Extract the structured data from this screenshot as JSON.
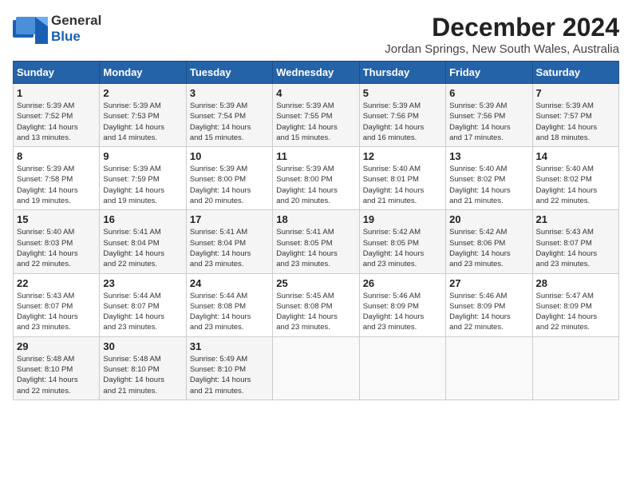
{
  "header": {
    "logo_line1": "General",
    "logo_line2": "Blue",
    "main_title": "December 2024",
    "subtitle": "Jordan Springs, New South Wales, Australia"
  },
  "calendar": {
    "weekdays": [
      "Sunday",
      "Monday",
      "Tuesday",
      "Wednesday",
      "Thursday",
      "Friday",
      "Saturday"
    ],
    "weeks": [
      [
        {
          "day": "1",
          "info": "Sunrise: 5:39 AM\nSunset: 7:52 PM\nDaylight: 14 hours\nand 13 minutes."
        },
        {
          "day": "2",
          "info": "Sunrise: 5:39 AM\nSunset: 7:53 PM\nDaylight: 14 hours\nand 14 minutes."
        },
        {
          "day": "3",
          "info": "Sunrise: 5:39 AM\nSunset: 7:54 PM\nDaylight: 14 hours\nand 15 minutes."
        },
        {
          "day": "4",
          "info": "Sunrise: 5:39 AM\nSunset: 7:55 PM\nDaylight: 14 hours\nand 15 minutes."
        },
        {
          "day": "5",
          "info": "Sunrise: 5:39 AM\nSunset: 7:56 PM\nDaylight: 14 hours\nand 16 minutes."
        },
        {
          "day": "6",
          "info": "Sunrise: 5:39 AM\nSunset: 7:56 PM\nDaylight: 14 hours\nand 17 minutes."
        },
        {
          "day": "7",
          "info": "Sunrise: 5:39 AM\nSunset: 7:57 PM\nDaylight: 14 hours\nand 18 minutes."
        }
      ],
      [
        {
          "day": "8",
          "info": "Sunrise: 5:39 AM\nSunset: 7:58 PM\nDaylight: 14 hours\nand 19 minutes."
        },
        {
          "day": "9",
          "info": "Sunrise: 5:39 AM\nSunset: 7:59 PM\nDaylight: 14 hours\nand 19 minutes."
        },
        {
          "day": "10",
          "info": "Sunrise: 5:39 AM\nSunset: 8:00 PM\nDaylight: 14 hours\nand 20 minutes."
        },
        {
          "day": "11",
          "info": "Sunrise: 5:39 AM\nSunset: 8:00 PM\nDaylight: 14 hours\nand 20 minutes."
        },
        {
          "day": "12",
          "info": "Sunrise: 5:40 AM\nSunset: 8:01 PM\nDaylight: 14 hours\nand 21 minutes."
        },
        {
          "day": "13",
          "info": "Sunrise: 5:40 AM\nSunset: 8:02 PM\nDaylight: 14 hours\nand 21 minutes."
        },
        {
          "day": "14",
          "info": "Sunrise: 5:40 AM\nSunset: 8:02 PM\nDaylight: 14 hours\nand 22 minutes."
        }
      ],
      [
        {
          "day": "15",
          "info": "Sunrise: 5:40 AM\nSunset: 8:03 PM\nDaylight: 14 hours\nand 22 minutes."
        },
        {
          "day": "16",
          "info": "Sunrise: 5:41 AM\nSunset: 8:04 PM\nDaylight: 14 hours\nand 22 minutes."
        },
        {
          "day": "17",
          "info": "Sunrise: 5:41 AM\nSunset: 8:04 PM\nDaylight: 14 hours\nand 23 minutes."
        },
        {
          "day": "18",
          "info": "Sunrise: 5:41 AM\nSunset: 8:05 PM\nDaylight: 14 hours\nand 23 minutes."
        },
        {
          "day": "19",
          "info": "Sunrise: 5:42 AM\nSunset: 8:05 PM\nDaylight: 14 hours\nand 23 minutes."
        },
        {
          "day": "20",
          "info": "Sunrise: 5:42 AM\nSunset: 8:06 PM\nDaylight: 14 hours\nand 23 minutes."
        },
        {
          "day": "21",
          "info": "Sunrise: 5:43 AM\nSunset: 8:07 PM\nDaylight: 14 hours\nand 23 minutes."
        }
      ],
      [
        {
          "day": "22",
          "info": "Sunrise: 5:43 AM\nSunset: 8:07 PM\nDaylight: 14 hours\nand 23 minutes."
        },
        {
          "day": "23",
          "info": "Sunrise: 5:44 AM\nSunset: 8:07 PM\nDaylight: 14 hours\nand 23 minutes."
        },
        {
          "day": "24",
          "info": "Sunrise: 5:44 AM\nSunset: 8:08 PM\nDaylight: 14 hours\nand 23 minutes."
        },
        {
          "day": "25",
          "info": "Sunrise: 5:45 AM\nSunset: 8:08 PM\nDaylight: 14 hours\nand 23 minutes."
        },
        {
          "day": "26",
          "info": "Sunrise: 5:46 AM\nSunset: 8:09 PM\nDaylight: 14 hours\nand 23 minutes."
        },
        {
          "day": "27",
          "info": "Sunrise: 5:46 AM\nSunset: 8:09 PM\nDaylight: 14 hours\nand 22 minutes."
        },
        {
          "day": "28",
          "info": "Sunrise: 5:47 AM\nSunset: 8:09 PM\nDaylight: 14 hours\nand 22 minutes."
        }
      ],
      [
        {
          "day": "29",
          "info": "Sunrise: 5:48 AM\nSunset: 8:10 PM\nDaylight: 14 hours\nand 22 minutes."
        },
        {
          "day": "30",
          "info": "Sunrise: 5:48 AM\nSunset: 8:10 PM\nDaylight: 14 hours\nand 21 minutes."
        },
        {
          "day": "31",
          "info": "Sunrise: 5:49 AM\nSunset: 8:10 PM\nDaylight: 14 hours\nand 21 minutes."
        },
        {
          "day": "",
          "info": ""
        },
        {
          "day": "",
          "info": ""
        },
        {
          "day": "",
          "info": ""
        },
        {
          "day": "",
          "info": ""
        }
      ]
    ]
  }
}
